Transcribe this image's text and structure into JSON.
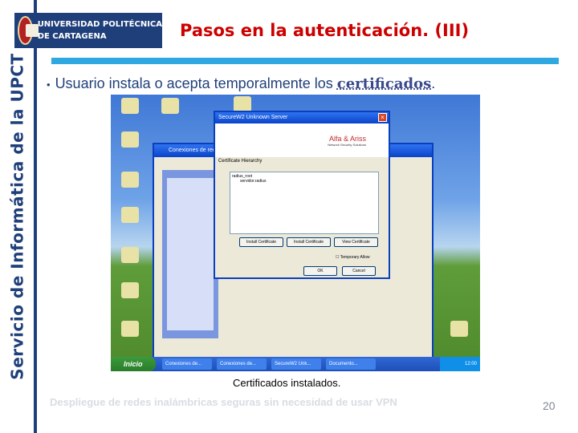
{
  "sidebar": {
    "vertical_title": "Servicio de Informática de la UPCT"
  },
  "logo": {
    "line1": "UNIVERSIDAD POLITÉCNICA",
    "line1_ghost": "LITÉCNICA",
    "line2": "DE CARTAGENA",
    "line2_ghost": "GENA"
  },
  "slide": {
    "title": "Pasos en la autenticación. (III)",
    "bullet_prefix": "Usuario instala o acepta temporalmente los ",
    "bullet_emphasis": "certificados",
    "bullet_suffix": "."
  },
  "screenshot": {
    "front_window_title": "SecureW2 Unknown Server",
    "brand_name": "Alfa & Ariss",
    "brand_tagline": "Network Security Solutions",
    "cert_label": "Certificate Hierarchy",
    "tree_items": [
      "radius_root",
      "servidor.radius"
    ],
    "buttons": [
      "Install Certificate",
      "Install Certificate",
      "View Certificate"
    ],
    "checkbox_label": "Temporary Allow",
    "ok_label": "OK",
    "cancel_label": "Cancel",
    "back_window_title": "Conexiones de red",
    "start_label": "Inicio",
    "taskbar_items": [
      "Conexiones de...",
      "Conexiones de...",
      "SecureW2 Unk...",
      "Documento..."
    ],
    "tray_time": "12:00"
  },
  "colors": {
    "accent_blue": "#1f3f7a",
    "title_red": "#cc0000",
    "rule_blue": "#2fa7e0"
  },
  "caption": "Certificados instalados.",
  "footer": "Despliegue de redes inalámbricas seguras sin necesidad de usar VPN",
  "page_number": "20"
}
